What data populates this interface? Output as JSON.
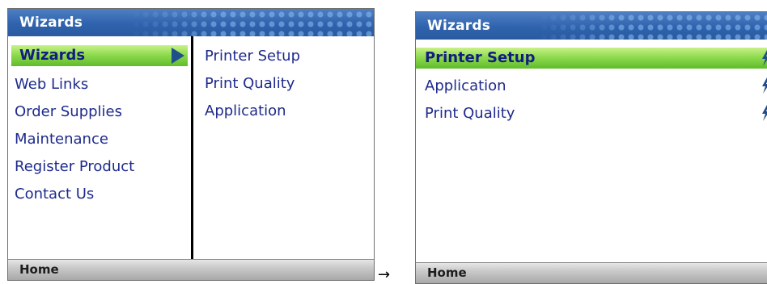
{
  "transition_arrow": "→",
  "left_screen": {
    "title": "Wizards",
    "menu": [
      "Wizards",
      "Web Links",
      "Order Supplies",
      "Maintenance",
      "Register Product",
      "Contact Us"
    ],
    "selected_index": 0,
    "submenu": [
      "Printer Setup",
      "Print Quality",
      "Application"
    ],
    "bottom_label": "Home"
  },
  "right_screen": {
    "title": "Wizards",
    "items": [
      "Printer Setup",
      "Application",
      "Print Quality"
    ],
    "selected_index": 0,
    "bottom_label": "Home"
  },
  "colors": {
    "titlebar_blue": "#2f63ad",
    "selected_green": "#8fdb4f",
    "menu_text_blue": "#1e2a8c",
    "bottombar_gray": "#c9c9c9"
  }
}
